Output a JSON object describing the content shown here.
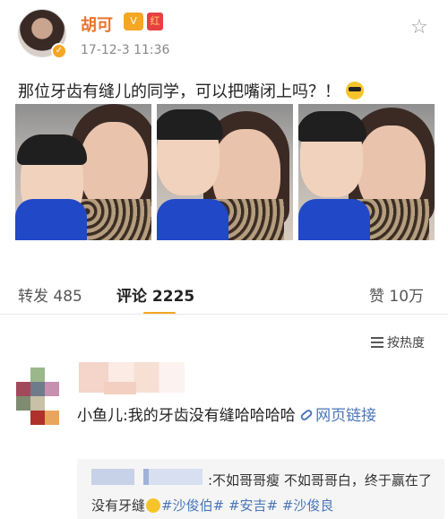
{
  "post": {
    "username": "胡可",
    "vip_badge": "V",
    "redpack_badge": "红",
    "timestamp": "17-12-3 11:36",
    "text": "那位牙齿有缝儿的同学，可以把嘴闭上吗？！",
    "emoji": "cool-sunglasses-emoji",
    "photo_count": 3
  },
  "stats": {
    "repost_label": "转发",
    "repost_count": "485",
    "comment_label": "评论",
    "comment_count": "2225",
    "like_label": "赞",
    "like_count": "10万"
  },
  "sort": {
    "label": "按热度"
  },
  "comment": {
    "text": "小鱼儿:我的牙齿没有缝哈哈哈哈",
    "link_label": "网页链接"
  },
  "reply": {
    "text_prefix": ":不如哥哥瘦 不如哥哥白，终于赢在了没有牙缝",
    "hashtags": [
      "#沙俊伯#",
      "#安吉#",
      "#沙俊良"
    ]
  },
  "colors": {
    "username": "#e8742d",
    "link": "#4a76b8",
    "accent": "#f5a623"
  }
}
